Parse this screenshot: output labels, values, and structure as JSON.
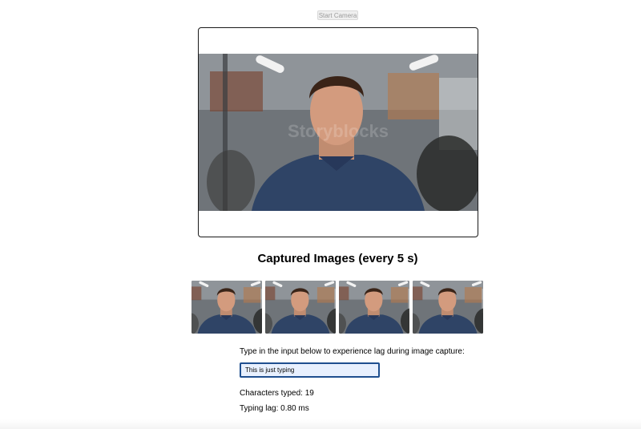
{
  "controls": {
    "start_camera_label": "Start Camera"
  },
  "camera": {
    "watermark_text": "Storyblocks"
  },
  "gallery": {
    "title": "Captured Images (every 5 s)",
    "image_count": 4
  },
  "typing_test": {
    "instructions": "Type in the input below to experience lag during image capture:",
    "input_value": "This is just typing",
    "characters_typed_label": "Characters typed: ",
    "characters_typed": "19",
    "typing_lag_label": "Typing lag: ",
    "typing_lag": "0.80 ms"
  },
  "colors": {
    "input_background": "#e8f0fe",
    "input_border": "#1f4f8f",
    "button_text_disabled": "#9b9b9b"
  }
}
